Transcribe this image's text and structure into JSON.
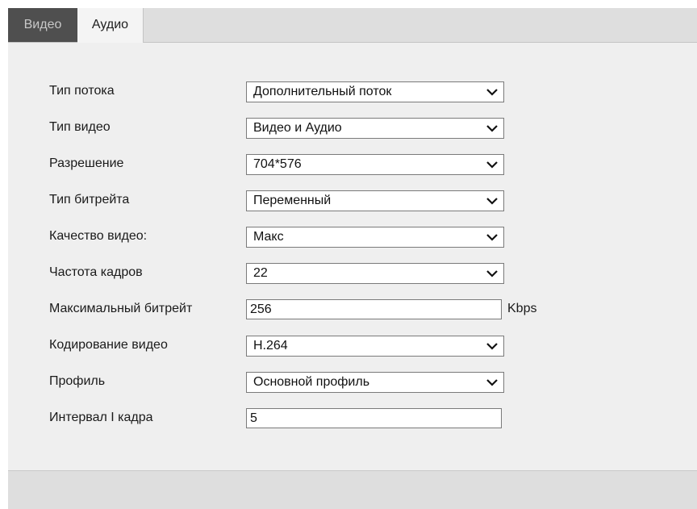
{
  "tabs": {
    "video": "Видео",
    "audio": "Аудио"
  },
  "form": {
    "stream_type": {
      "label": "Тип потока",
      "value": "Дополнительный поток"
    },
    "video_type": {
      "label": "Тип видео",
      "value": "Видео и Аудио"
    },
    "resolution": {
      "label": "Разрешение",
      "value": "704*576"
    },
    "bitrate_type": {
      "label": "Тип битрейта",
      "value": "Переменный"
    },
    "video_quality": {
      "label": "Качество видео:",
      "value": "Макс"
    },
    "frame_rate": {
      "label": "Частота кадров",
      "value": "22"
    },
    "max_bitrate": {
      "label": "Максимальный битрейт",
      "value": "256",
      "unit": "Kbps"
    },
    "video_encoding": {
      "label": "Кодирование видео",
      "value": "H.264"
    },
    "profile": {
      "label": "Профиль",
      "value": "Основной профиль"
    },
    "i_frame_interval": {
      "label": "Интервал I кадра",
      "value": "5"
    }
  },
  "colors": {
    "active_tab_bg": "#4f4f4f",
    "active_tab_text": "#c8c8c8",
    "panel_bg": "#efefef",
    "page_bg": "#dedede"
  },
  "icons": {
    "dropdown": "chevron-down-icon"
  }
}
